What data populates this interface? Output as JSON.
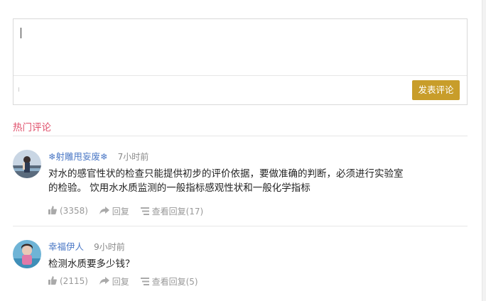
{
  "editor": {
    "submit_label": "发表评论"
  },
  "hot_comments": {
    "title": "热门评论",
    "comments": [
      {
        "username": "❄射雕甩妄废❄",
        "time": "7小时前",
        "text": "对水的感官性状的检查只能提供初步的评价依据，要做准确的判断，必须进行实验室的检验。 饮用水水质监测的一般指标感观性状和一般化学指标",
        "likes": "(3358)",
        "reply_label": "回复",
        "view_replies": "查看回复(17)"
      },
      {
        "username": "幸福伊人",
        "time": "9小时前",
        "text": "检测水质要多少钱？",
        "likes": "(2115)",
        "reply_label": "回复",
        "view_replies": "查看回复(5)"
      }
    ]
  },
  "icons": {
    "like": "thumbs-up-icon",
    "reply": "reply-arrow-icon",
    "replies": "list-icon"
  },
  "colors": {
    "accent_button": "#c89d2a",
    "section_title": "#e0506b",
    "username": "#4c79c6"
  }
}
